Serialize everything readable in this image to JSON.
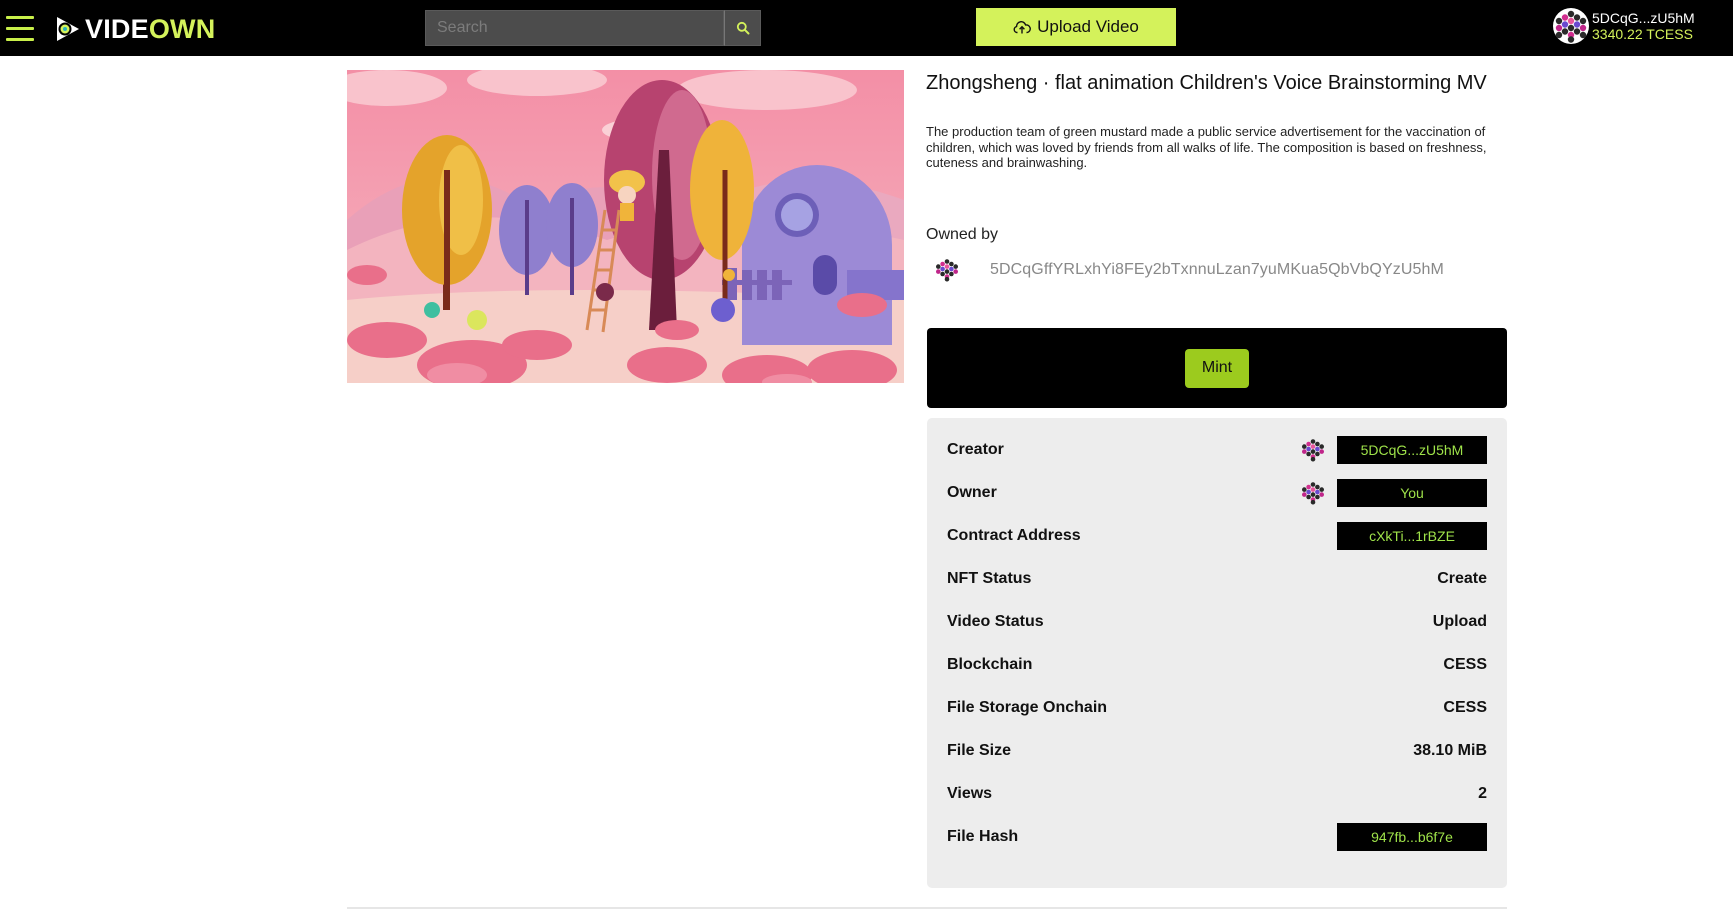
{
  "header": {
    "logo": {
      "part1": "VIDE",
      "part2": "OWN"
    },
    "search": {
      "placeholder": "Search"
    },
    "upload_label": "Upload Video",
    "account": {
      "address_short": "5DCqG...zU5hM",
      "balance": "3340.22 TCESS"
    }
  },
  "video": {
    "title": "Zhongsheng · flat animation Children's Voice Brainstorming MV",
    "description": "The production team of green mustard made a public service advertisement for the vaccination of children, which was loved by friends from all walks of life. The composition is based on freshness, cuteness and brainwashing.",
    "owned_by_label": "Owned by",
    "owner_full_address": "5DCqGffYRLxhYi8FEy2bTxnnuLzan7yuMKua5QbVbQYzU5hM",
    "mint_label": "Mint"
  },
  "properties": [
    {
      "label": "Creator",
      "value": "5DCqG...zU5hM",
      "kind": "chip",
      "avatar": true
    },
    {
      "label": "Owner",
      "value": "You",
      "kind": "chip",
      "avatar": true
    },
    {
      "label": "Contract Address",
      "value": "cXkTi...1rBZE",
      "kind": "chip",
      "avatar": false
    },
    {
      "label": "NFT Status",
      "value": "Create",
      "kind": "text"
    },
    {
      "label": "Video Status",
      "value": "Upload",
      "kind": "text"
    },
    {
      "label": "Blockchain",
      "value": "CESS",
      "kind": "text"
    },
    {
      "label": "File Storage Onchain",
      "value": "CESS",
      "kind": "text"
    },
    {
      "label": "File Size",
      "value": "38.10 MiB",
      "kind": "text"
    },
    {
      "label": "Views",
      "value": "2",
      "kind": "text"
    },
    {
      "label": "File Hash",
      "value": "947fb...b6f7e",
      "kind": "chip",
      "avatar": false
    }
  ],
  "colors": {
    "accent": "#d4f25b",
    "mint": "#9ccb1e",
    "chip_text": "#9fe34a",
    "header_bg": "#000000",
    "panel_bg": "#ededed"
  },
  "icons": {
    "menu": "hamburger-icon",
    "search": "search-icon",
    "upload": "cloud-upload-icon",
    "avatar": "identicon"
  }
}
